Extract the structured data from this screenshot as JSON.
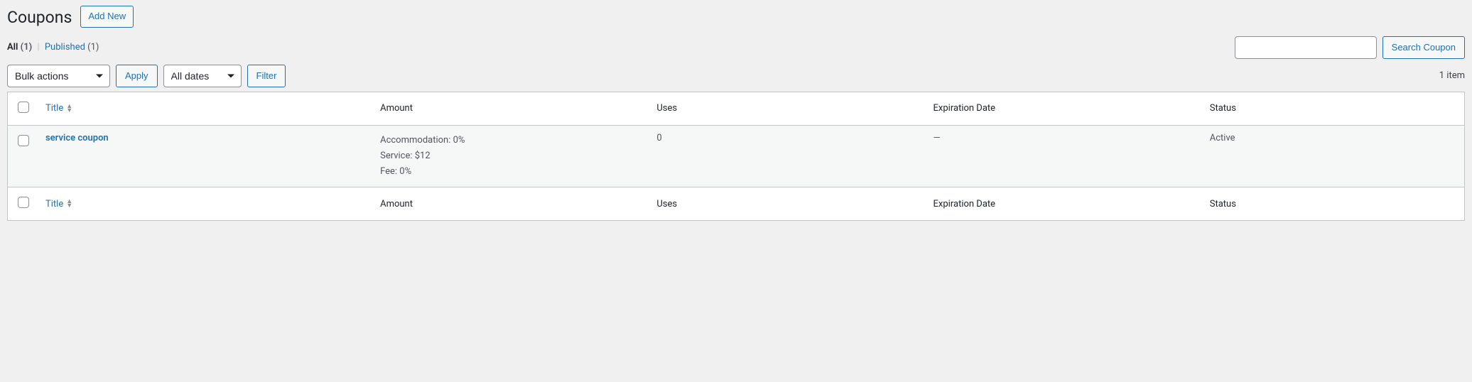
{
  "header": {
    "title": "Coupons",
    "add_new": "Add New"
  },
  "filters": {
    "all_label": "All",
    "all_count": "(1)",
    "published_label": "Published",
    "published_count": "(1)"
  },
  "search": {
    "placeholder": "",
    "button": "Search Coupon"
  },
  "bulk": {
    "actions_label": "Bulk actions",
    "apply": "Apply"
  },
  "date": {
    "all_dates": "All dates",
    "filter": "Filter"
  },
  "count": {
    "text": "1 item"
  },
  "columns": {
    "title": "Title",
    "amount": "Amount",
    "uses": "Uses",
    "expiration": "Expiration Date",
    "status": "Status"
  },
  "rows": [
    {
      "title": "service coupon",
      "amount_line1": "Accommodation: 0%",
      "amount_line2": "Service: $12",
      "amount_line3": "Fee: 0%",
      "uses": "0",
      "expiration": "—",
      "status": "Active"
    }
  ]
}
